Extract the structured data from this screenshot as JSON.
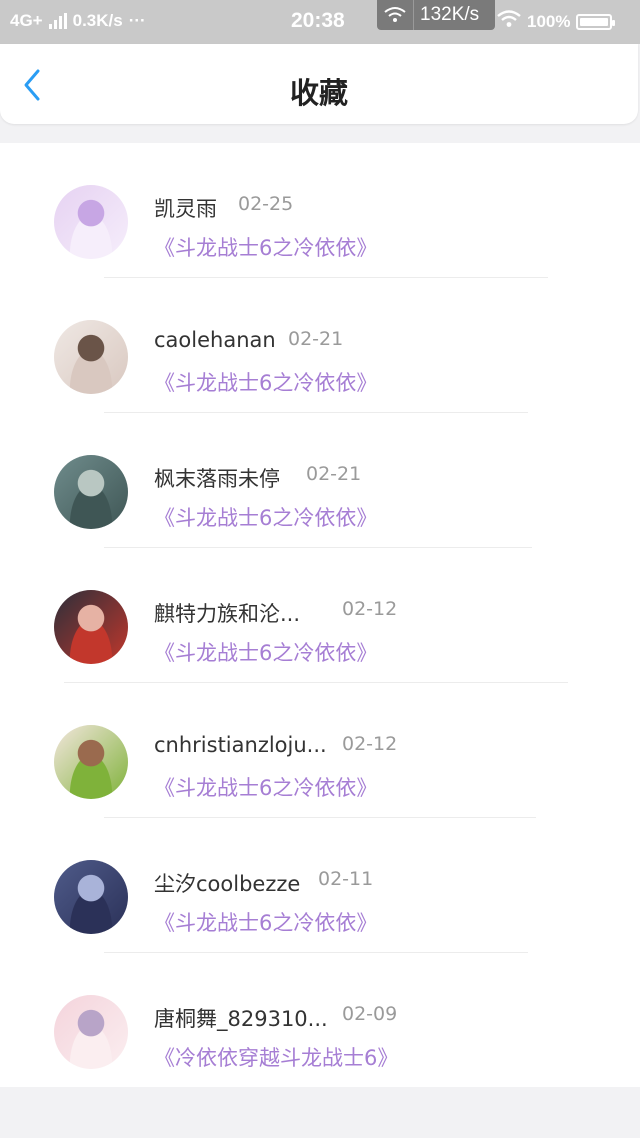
{
  "status_bar": {
    "network": "4G+",
    "speed_left": "0.3K/s",
    "more": "···",
    "time": "20:38",
    "speed_badge": "132K/s",
    "battery": "100%"
  },
  "header": {
    "title": "收藏"
  },
  "items": [
    {
      "name": "凯灵雨",
      "date": "02-25",
      "book": "《斗龙战士6之冷依依》",
      "avatar_colors": [
        "#e6d2f2",
        "#c7a6e4",
        "#f6eefb"
      ]
    },
    {
      "name": "caolehanan",
      "date": "02-21",
      "book": "《斗龙战士6之冷依依》",
      "avatar_colors": [
        "#efe8e4",
        "#6a5448",
        "#d9c8c0"
      ]
    },
    {
      "name": "枫末落雨未停",
      "date": "02-21",
      "book": "《斗龙战士6之冷依依》",
      "avatar_colors": [
        "#6f8c8c",
        "#b9c7c2",
        "#3f5655"
      ]
    },
    {
      "name": "麒特力族和沦...",
      "date": "02-12",
      "book": "《斗龙战士6之冷依依》",
      "avatar_colors": [
        "#2c2f3a",
        "#e6b2a4",
        "#c2372c"
      ]
    },
    {
      "name": "cnhristianzloju...",
      "date": "02-12",
      "book": "《斗龙战士6之冷依依》",
      "avatar_colors": [
        "#f3e6dd",
        "#9a6a4e",
        "#7fb23a"
      ]
    },
    {
      "name": "尘汐coolbezze",
      "date": "02-11",
      "book": "《斗龙战士6之冷依依》",
      "avatar_colors": [
        "#4f5b8a",
        "#a9b3d9",
        "#2b3158"
      ]
    },
    {
      "name": "唐桐舞_829310...",
      "date": "02-09",
      "book": "《冷依依穿越斗龙战士6》",
      "avatar_colors": [
        "#f4d4dc",
        "#b8a4c8",
        "#fbeef0"
      ]
    }
  ]
}
